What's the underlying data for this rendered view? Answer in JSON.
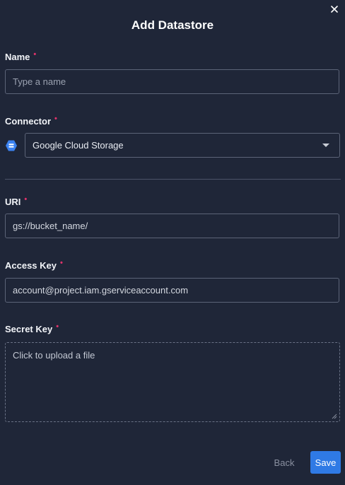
{
  "dialog": {
    "title": "Add Datastore",
    "close_icon": "close-icon"
  },
  "form": {
    "name": {
      "label": "Name",
      "required_marker": "•",
      "value": "",
      "placeholder": "Type a name"
    },
    "connector": {
      "label": "Connector",
      "required_marker": "•",
      "icon": "google-cloud-storage-icon",
      "selected": "Google Cloud Storage"
    },
    "uri": {
      "label": "URI",
      "required_marker": "•",
      "value": "gs://bucket_name/"
    },
    "access_key": {
      "label": "Access Key",
      "required_marker": "•",
      "value": "account@project.iam.gserviceaccount.com"
    },
    "secret_key": {
      "label": "Secret Key",
      "required_marker": "•",
      "upload_text": "Click to upload a file"
    }
  },
  "footer": {
    "back_label": "Back",
    "save_label": "Save"
  },
  "colors": {
    "background": "#1f2638",
    "required": "#e0336b",
    "primary": "#2f7ae5",
    "connector_icon": "#3b82f0"
  }
}
